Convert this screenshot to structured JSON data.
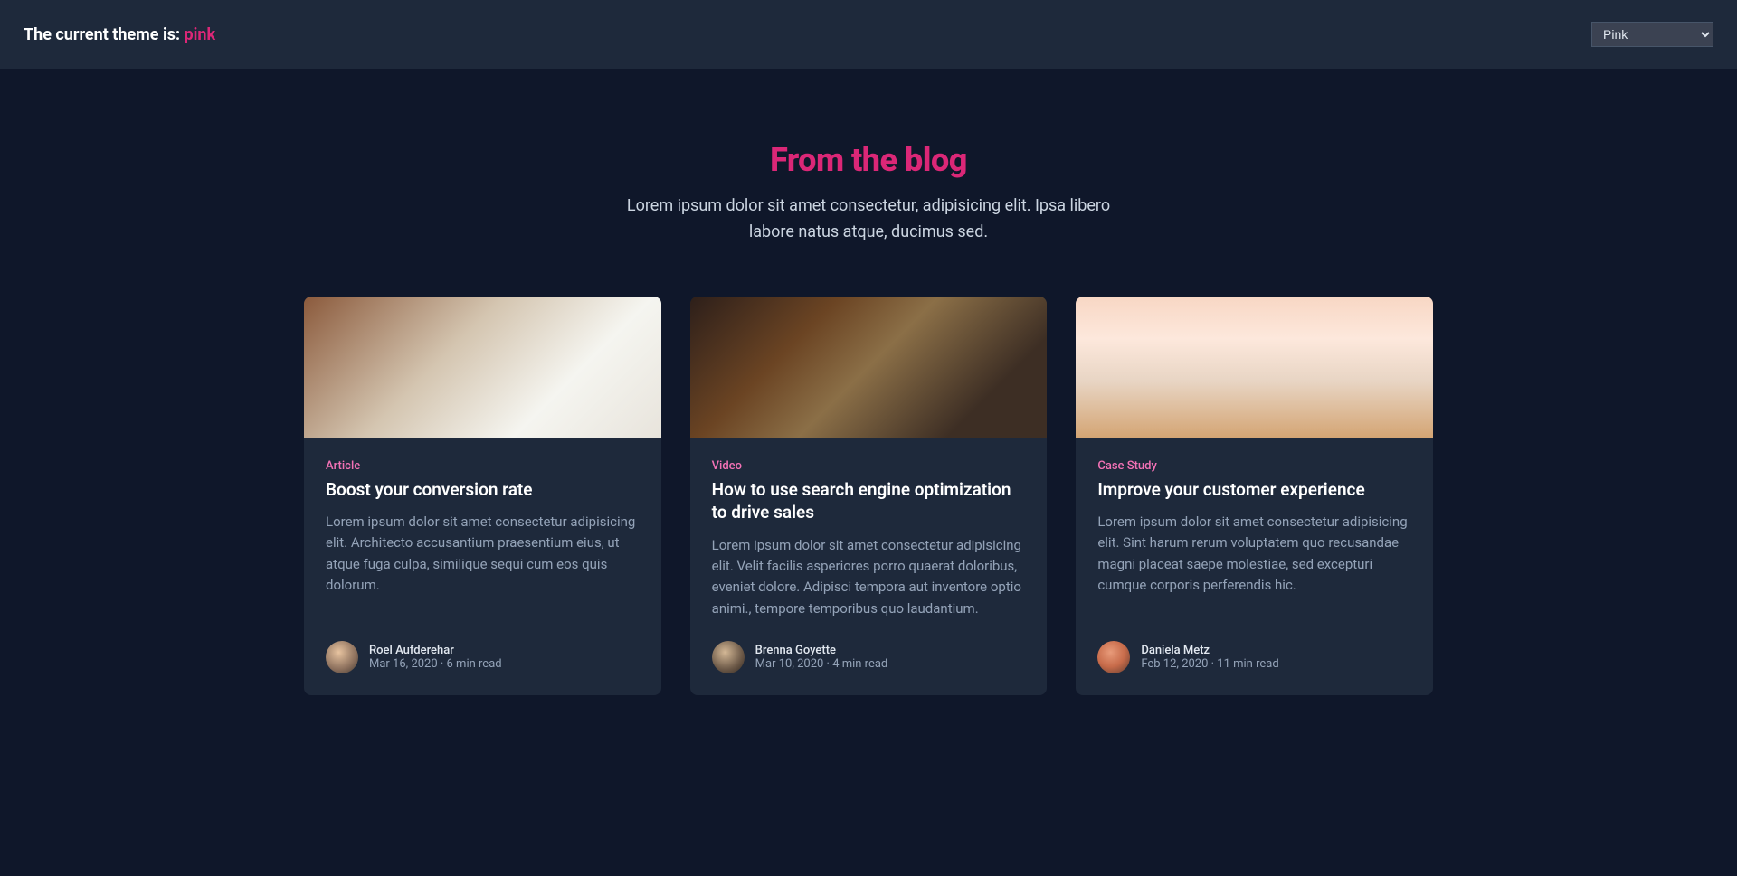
{
  "header": {
    "theme_prefix": "The current theme is: ",
    "theme_name": "pink",
    "theme_select_value": "Pink"
  },
  "hero": {
    "title": "From the blog",
    "subtitle": "Lorem ipsum dolor sit amet consectetur, adipisicing elit. Ipsa libero labore natus atque, ducimus sed."
  },
  "cards": [
    {
      "category": "Article",
      "title": "Boost your conversion rate",
      "excerpt": "Lorem ipsum dolor sit amet consectetur adipisicing elit. Architecto accusantium praesentium eius, ut atque fuga culpa, similique sequi cum eos quis dolorum.",
      "author": "Roel Aufderehar",
      "date": "Mar 16, 2020",
      "read": "6 min read"
    },
    {
      "category": "Video",
      "title": "How to use search engine optimization to drive sales",
      "excerpt": "Lorem ipsum dolor sit amet consectetur adipisicing elit. Velit facilis asperiores porro quaerat doloribus, eveniet dolore. Adipisci tempora aut inventore optio animi., tempore temporibus quo laudantium.",
      "author": "Brenna Goyette",
      "date": "Mar 10, 2020",
      "read": "4 min read"
    },
    {
      "category": "Case Study",
      "title": "Improve your customer experience",
      "excerpt": "Lorem ipsum dolor sit amet consectetur adipisicing elit. Sint harum rerum voluptatem quo recusandae magni placeat saepe molestiae, sed excepturi cumque corporis perferendis hic.",
      "author": "Daniela Metz",
      "date": "Feb 12, 2020",
      "read": "11 min read"
    }
  ]
}
